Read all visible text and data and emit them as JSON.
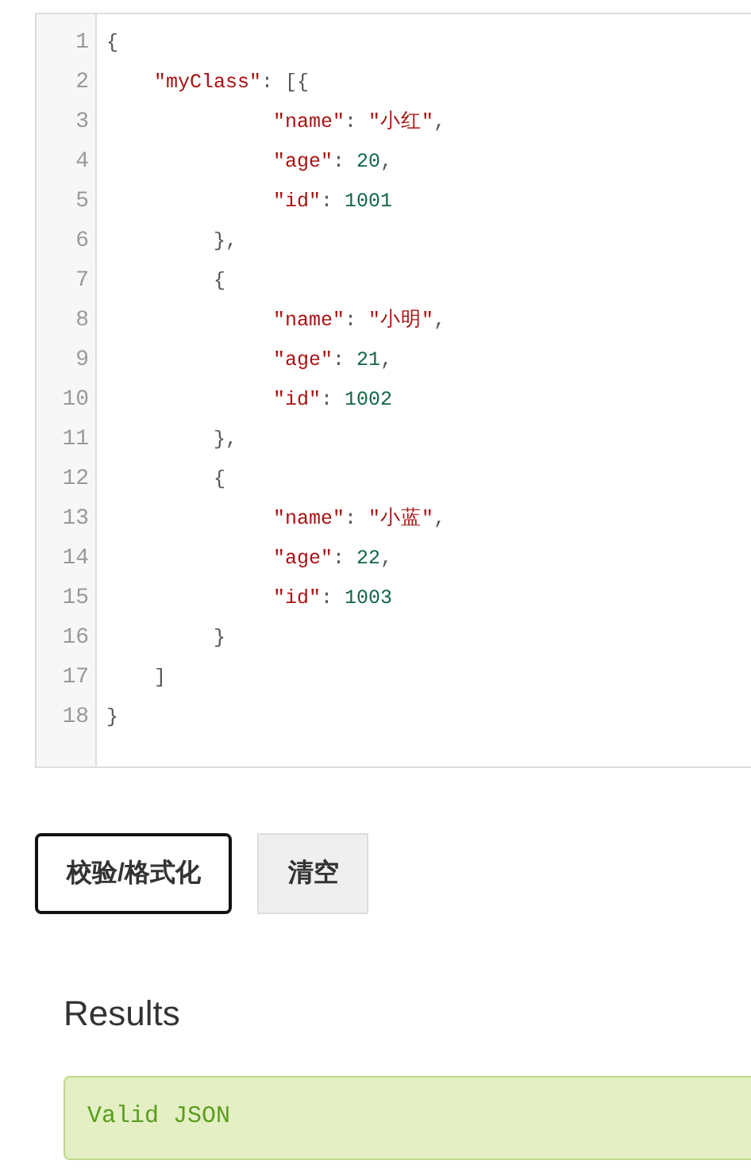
{
  "editor": {
    "lines": [
      {
        "number": "1",
        "tokens": [
          {
            "kind": "punct",
            "text": "{"
          }
        ]
      },
      {
        "number": "2",
        "tokens": [
          {
            "kind": "key",
            "text": "    \"myClass\""
          },
          {
            "kind": "punct",
            "text": ": [{"
          }
        ]
      },
      {
        "number": "3",
        "tokens": [
          {
            "kind": "key",
            "text": "              \"name\""
          },
          {
            "kind": "punct",
            "text": ": "
          },
          {
            "kind": "string",
            "text": "\"小红\""
          },
          {
            "kind": "punct",
            "text": ","
          }
        ]
      },
      {
        "number": "4",
        "tokens": [
          {
            "kind": "key",
            "text": "              \"age\""
          },
          {
            "kind": "punct",
            "text": ": "
          },
          {
            "kind": "number",
            "text": "20"
          },
          {
            "kind": "punct",
            "text": ","
          }
        ]
      },
      {
        "number": "5",
        "tokens": [
          {
            "kind": "key",
            "text": "              \"id\""
          },
          {
            "kind": "punct",
            "text": ": "
          },
          {
            "kind": "number",
            "text": "1001"
          }
        ]
      },
      {
        "number": "6",
        "tokens": [
          {
            "kind": "punct",
            "text": "         },"
          }
        ]
      },
      {
        "number": "7",
        "tokens": [
          {
            "kind": "punct",
            "text": "         {"
          }
        ]
      },
      {
        "number": "8",
        "tokens": [
          {
            "kind": "key",
            "text": "              \"name\""
          },
          {
            "kind": "punct",
            "text": ": "
          },
          {
            "kind": "string",
            "text": "\"小明\""
          },
          {
            "kind": "punct",
            "text": ","
          }
        ]
      },
      {
        "number": "9",
        "tokens": [
          {
            "kind": "key",
            "text": "              \"age\""
          },
          {
            "kind": "punct",
            "text": ": "
          },
          {
            "kind": "number",
            "text": "21"
          },
          {
            "kind": "punct",
            "text": ","
          }
        ]
      },
      {
        "number": "10",
        "tokens": [
          {
            "kind": "key",
            "text": "              \"id\""
          },
          {
            "kind": "punct",
            "text": ": "
          },
          {
            "kind": "number",
            "text": "1002"
          }
        ]
      },
      {
        "number": "11",
        "tokens": [
          {
            "kind": "punct",
            "text": "         },"
          }
        ]
      },
      {
        "number": "12",
        "tokens": [
          {
            "kind": "punct",
            "text": "         {"
          }
        ]
      },
      {
        "number": "13",
        "tokens": [
          {
            "kind": "key",
            "text": "              \"name\""
          },
          {
            "kind": "punct",
            "text": ": "
          },
          {
            "kind": "string",
            "text": "\"小蓝\""
          },
          {
            "kind": "punct",
            "text": ","
          }
        ]
      },
      {
        "number": "14",
        "tokens": [
          {
            "kind": "key",
            "text": "              \"age\""
          },
          {
            "kind": "punct",
            "text": ": "
          },
          {
            "kind": "number",
            "text": "22"
          },
          {
            "kind": "punct",
            "text": ","
          }
        ]
      },
      {
        "number": "15",
        "tokens": [
          {
            "kind": "key",
            "text": "              \"id\""
          },
          {
            "kind": "punct",
            "text": ": "
          },
          {
            "kind": "number",
            "text": "1003"
          }
        ]
      },
      {
        "number": "16",
        "tokens": [
          {
            "kind": "punct",
            "text": "         }"
          }
        ]
      },
      {
        "number": "17",
        "tokens": [
          {
            "kind": "punct",
            "text": "    ]"
          }
        ]
      },
      {
        "number": "18",
        "tokens": [
          {
            "kind": "punct",
            "text": "}"
          }
        ]
      }
    ]
  },
  "buttons": [
    {
      "label": "校验/格式化",
      "kind": "outline"
    },
    {
      "label": "清空",
      "kind": "plain"
    }
  ],
  "results": {
    "title": "Results",
    "message": "Valid JSON",
    "valid": true
  }
}
